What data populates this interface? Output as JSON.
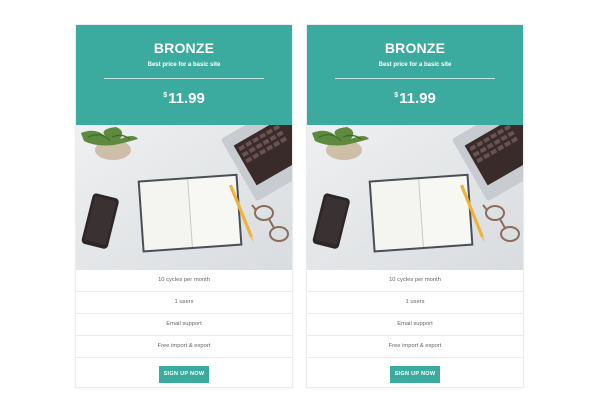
{
  "plans": [
    {
      "name": "BRONZE",
      "subtitle": "Best price for a basic site",
      "currency": "$",
      "price": "11.99",
      "image": "desk-workspace-photo",
      "features": [
        "10 cycles per month",
        "1 users",
        "Email support",
        "Free import & export"
      ],
      "cta": "SIGN UP NOW"
    },
    {
      "name": "BRONZE",
      "subtitle": "Best price for a basic site",
      "currency": "$",
      "price": "11.99",
      "image": "desk-workspace-photo",
      "features": [
        "10 cycles per month",
        "1 users",
        "Email support",
        "Free import & export"
      ],
      "cta": "SIGN UP NOW"
    }
  ],
  "colors": {
    "accent": "#3bab9f",
    "feature_text": "#666666",
    "divider": "#ebebeb"
  }
}
